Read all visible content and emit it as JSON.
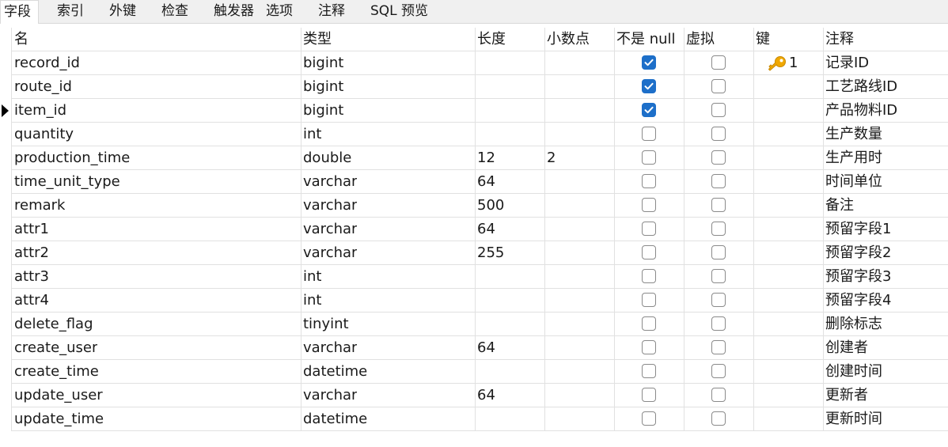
{
  "tabs": [
    {
      "label": "字段",
      "active": true
    },
    {
      "label": "索引",
      "active": false
    },
    {
      "label": "外键",
      "active": false
    },
    {
      "label": "检查",
      "active": false
    },
    {
      "label": "触发器",
      "active": false
    },
    {
      "label": "选项",
      "active": false
    },
    {
      "label": "注释",
      "active": false
    },
    {
      "label": "SQL 预览",
      "active": false
    }
  ],
  "columns": {
    "name": "名",
    "type": "类型",
    "length": "长度",
    "decimals": "小数点",
    "not_null": "不是 null",
    "virtual": "虚拟",
    "key": "键",
    "comment": "注释"
  },
  "rows": [
    {
      "name": "record_id",
      "type": "bigint",
      "length": "",
      "decimals": "",
      "not_null": true,
      "virtual": false,
      "key": "1",
      "comment": "记录ID",
      "current": false
    },
    {
      "name": "route_id",
      "type": "bigint",
      "length": "",
      "decimals": "",
      "not_null": true,
      "virtual": false,
      "key": "",
      "comment": "工艺路线ID",
      "current": false
    },
    {
      "name": "item_id",
      "type": "bigint",
      "length": "",
      "decimals": "",
      "not_null": true,
      "virtual": false,
      "key": "",
      "comment": "产品物料ID",
      "current": true
    },
    {
      "name": "quantity",
      "type": "int",
      "length": "",
      "decimals": "",
      "not_null": false,
      "virtual": false,
      "key": "",
      "comment": "生产数量",
      "current": false
    },
    {
      "name": "production_time",
      "type": "double",
      "length": "12",
      "decimals": "2",
      "not_null": false,
      "virtual": false,
      "key": "",
      "comment": "生产用时",
      "current": false
    },
    {
      "name": "time_unit_type",
      "type": "varchar",
      "length": "64",
      "decimals": "",
      "not_null": false,
      "virtual": false,
      "key": "",
      "comment": "时间单位",
      "current": false
    },
    {
      "name": "remark",
      "type": "varchar",
      "length": "500",
      "decimals": "",
      "not_null": false,
      "virtual": false,
      "key": "",
      "comment": "备注",
      "current": false
    },
    {
      "name": "attr1",
      "type": "varchar",
      "length": "64",
      "decimals": "",
      "not_null": false,
      "virtual": false,
      "key": "",
      "comment": "预留字段1",
      "current": false
    },
    {
      "name": "attr2",
      "type": "varchar",
      "length": "255",
      "decimals": "",
      "not_null": false,
      "virtual": false,
      "key": "",
      "comment": "预留字段2",
      "current": false
    },
    {
      "name": "attr3",
      "type": "int",
      "length": "",
      "decimals": "",
      "not_null": false,
      "virtual": false,
      "key": "",
      "comment": "预留字段3",
      "current": false
    },
    {
      "name": "attr4",
      "type": "int",
      "length": "",
      "decimals": "",
      "not_null": false,
      "virtual": false,
      "key": "",
      "comment": "预留字段4",
      "current": false
    },
    {
      "name": "delete_flag",
      "type": "tinyint",
      "length": "",
      "decimals": "",
      "not_null": false,
      "virtual": false,
      "key": "",
      "comment": "删除标志",
      "current": false
    },
    {
      "name": "create_user",
      "type": "varchar",
      "length": "64",
      "decimals": "",
      "not_null": false,
      "virtual": false,
      "key": "",
      "comment": "创建者",
      "current": false
    },
    {
      "name": "create_time",
      "type": "datetime",
      "length": "",
      "decimals": "",
      "not_null": false,
      "virtual": false,
      "key": "",
      "comment": "创建时间",
      "current": false
    },
    {
      "name": "update_user",
      "type": "varchar",
      "length": "64",
      "decimals": "",
      "not_null": false,
      "virtual": false,
      "key": "",
      "comment": "更新者",
      "current": false
    },
    {
      "name": "update_time",
      "type": "datetime",
      "length": "",
      "decimals": "",
      "not_null": false,
      "virtual": false,
      "key": "",
      "comment": "更新时间",
      "current": false
    }
  ],
  "colors": {
    "checkbox_checked": "#1d6fc9",
    "key_icon": "#f0a800"
  },
  "icons": {
    "key": "key-icon",
    "row_pointer": "row-pointer-icon",
    "checked": "checkbox-checked-icon"
  }
}
